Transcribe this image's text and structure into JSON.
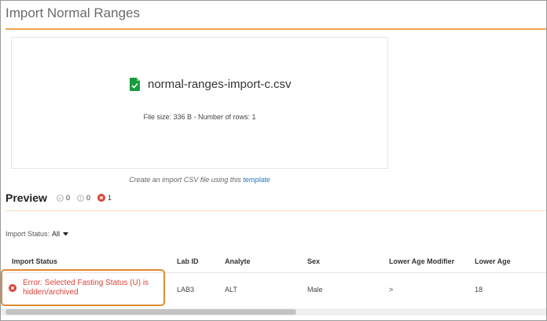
{
  "page": {
    "title": "Import Normal Ranges"
  },
  "upload": {
    "file_name": "normal-ranges-import-c.csv",
    "file_meta": "File size: 336 B - Number of rows: 1",
    "hint_prefix": "Create an import CSV file using this",
    "hint_link": "template"
  },
  "preview": {
    "title": "Preview",
    "counts": {
      "success": "0",
      "warning": "0",
      "error": "1"
    }
  },
  "filter": {
    "label": "Import Status:",
    "value": "All"
  },
  "table": {
    "headers": [
      "Import Status",
      "Lab ID",
      "Analyte",
      "Sex",
      "Lower Age Modifier",
      "Lower Age"
    ],
    "rows": [
      {
        "status": "Error: Selected Fasting Status (U) is hidden/archived",
        "lab_id": "LAB3",
        "analyte": "ALT",
        "sex": "Male",
        "lower_age_modifier": ">",
        "lower_age": "18"
      }
    ]
  },
  "colors": {
    "accent": "#f0a74a",
    "error": "#d9433a",
    "link": "#1e73be",
    "file_icon": "#1a9c3e"
  },
  "icons": {
    "file": "csv-file-icon",
    "success": "check-circle-icon",
    "warning": "warning-circle-icon",
    "error": "error-circle-icon",
    "filter_caret": "caret-down-icon"
  }
}
